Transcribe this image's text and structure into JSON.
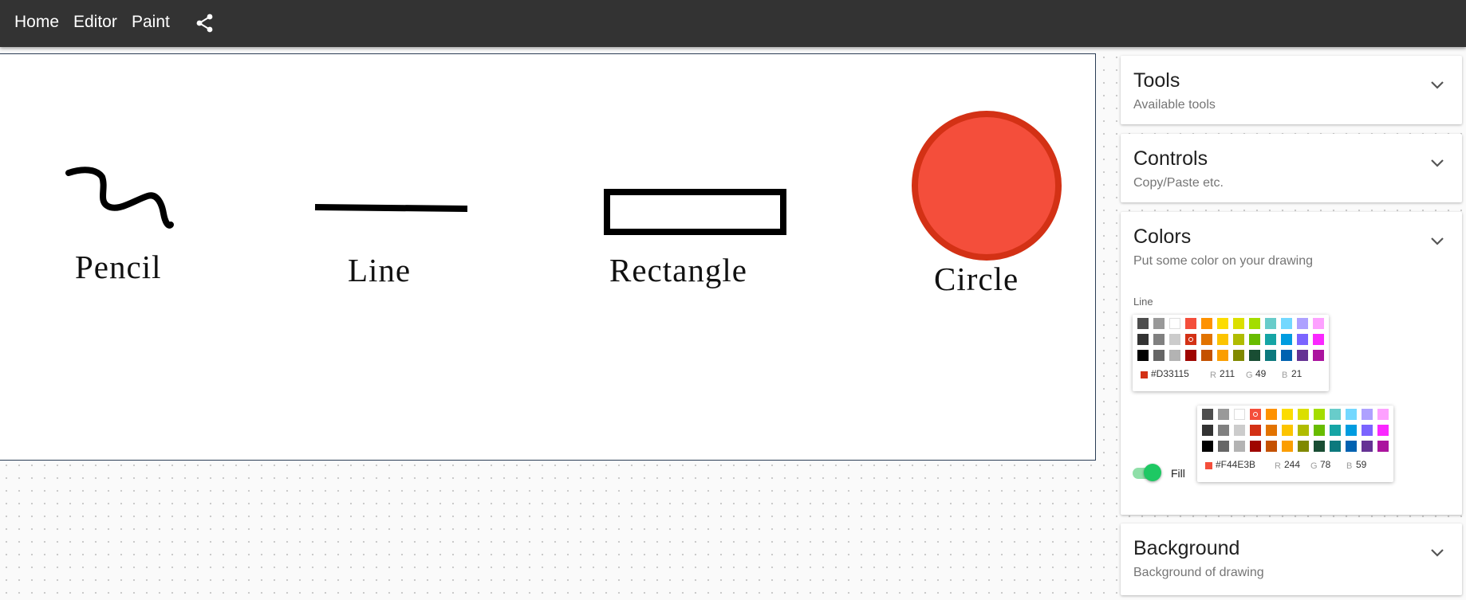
{
  "nav": {
    "home": "Home",
    "editor": "Editor",
    "paint": "Paint",
    "share_icon": "share-icon"
  },
  "canvas": {
    "labels": {
      "pencil": "Pencil",
      "line": "Line",
      "rectangle": "Rectangle",
      "circle": "Circle"
    },
    "colors": {
      "stroke": "#000000",
      "circle_fill": "#F44E3B",
      "circle_stroke": "#D33115"
    }
  },
  "panels": {
    "tools": {
      "title": "Tools",
      "subtitle": "Available tools",
      "icon": "chevron-down-icon"
    },
    "controls": {
      "title": "Controls",
      "subtitle": "Copy/Paste etc.",
      "icon": "chevron-down-icon"
    },
    "colors": {
      "title": "Colors",
      "subtitle": "Put some color on your drawing",
      "icon": "chevron-down-icon",
      "line_label": "Line",
      "fill_label": "Fill",
      "fill_enabled": true,
      "palette": [
        "#4D4D4D",
        "#999999",
        "#FFFFFF",
        "#F44E3B",
        "#FE9200",
        "#FCDC00",
        "#DBDF00",
        "#A4DD00",
        "#68CCCA",
        "#73D8FF",
        "#AEA1FF",
        "#FDA1FF",
        "#333333",
        "#808080",
        "#CCCCCC",
        "#D33115",
        "#E27300",
        "#FCC400",
        "#B0BC00",
        "#68BC00",
        "#16A5A5",
        "#009CE0",
        "#7B64FF",
        "#FA28FF",
        "#000000",
        "#666666",
        "#B3B3B3",
        "#9F0500",
        "#C45100",
        "#FB9E00",
        "#808900",
        "#194D33",
        "#0C797D",
        "#0062B1",
        "#653294",
        "#AB149E"
      ],
      "line_picker": {
        "hex": "#D33115",
        "r_label": "R",
        "r": "211",
        "g_label": "G",
        "g": "49",
        "b_label": "B",
        "b": "21"
      },
      "fill_picker": {
        "hex": "#F44E3B",
        "r_label": "R",
        "r": "244",
        "g_label": "G",
        "g": "78",
        "b_label": "B",
        "b": "59"
      }
    },
    "background": {
      "title": "Background",
      "subtitle": "Background of drawing",
      "icon": "chevron-down-icon"
    }
  }
}
